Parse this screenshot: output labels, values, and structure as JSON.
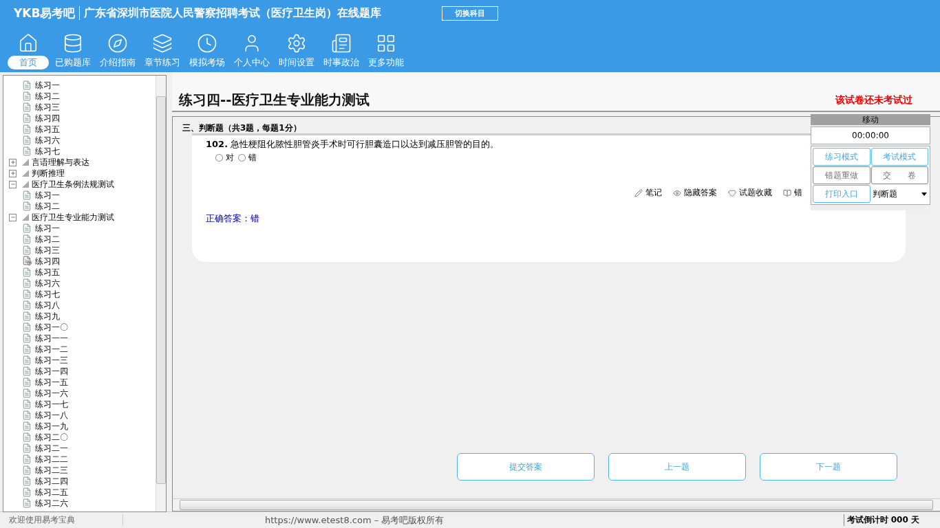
{
  "header": {
    "logo": "YKB易考吧",
    "title": "广东省深圳市医院人民警察招聘考试（医疗卫生岗）在线题库",
    "switch_button": "切换科目"
  },
  "nav": [
    {
      "label": "首页",
      "selected": true
    },
    {
      "label": "已购题库",
      "selected": false
    },
    {
      "label": "介绍指南",
      "selected": false
    },
    {
      "label": "章节练习",
      "selected": false
    },
    {
      "label": "模拟考场",
      "selected": false
    },
    {
      "label": "个人中心",
      "selected": false
    },
    {
      "label": "时间设置",
      "selected": false
    },
    {
      "label": "时事政治",
      "selected": false
    },
    {
      "label": "更多功能",
      "selected": false
    }
  ],
  "tree": [
    {
      "children": [
        {
          "children": [
            {
              "label": "练习一",
              "selected": false
            },
            {
              "label": "练习二",
              "selected": false
            },
            {
              "label": "练习三",
              "selected": false
            },
            {
              "label": "练习四",
              "selected": false
            },
            {
              "label": "练习五",
              "selected": false
            },
            {
              "label": "练习六",
              "selected": false
            },
            {
              "label": "练习七",
              "selected": false
            }
          ]
        },
        {
          "label": "言语理解与表达",
          "expanded": false
        },
        {
          "label": "判断推理",
          "expanded": false
        }
      ]
    },
    {
      "label": "医疗卫生条例法规测试",
      "expanded": true,
      "children": [
        {
          "label": "练习一",
          "selected": false
        },
        {
          "label": "练习二",
          "selected": false
        }
      ]
    },
    {
      "label": "医疗卫生专业能力测试",
      "expanded": true,
      "children": [
        {
          "label": "练习一",
          "selected": false
        },
        {
          "label": "练习二",
          "selected": false
        },
        {
          "label": "练习三",
          "selected": false
        },
        {
          "label": "练习四",
          "selected": true
        },
        {
          "label": "练习五",
          "selected": false
        },
        {
          "label": "练习六",
          "selected": false
        },
        {
          "label": "练习七",
          "selected": false
        },
        {
          "label": "练习八",
          "selected": false
        },
        {
          "label": "练习九",
          "selected": false
        },
        {
          "label": "练习一〇",
          "selected": false
        },
        {
          "label": "练习一一",
          "selected": false
        },
        {
          "label": "练习一二",
          "selected": false
        },
        {
          "label": "练习一三",
          "selected": false
        },
        {
          "label": "练习一四",
          "selected": false
        },
        {
          "label": "练习一五",
          "selected": false
        },
        {
          "label": "练习一六",
          "selected": false
        },
        {
          "label": "练习一七",
          "selected": false
        },
        {
          "label": "练习一八",
          "selected": false
        },
        {
          "label": "练习一九",
          "selected": false
        },
        {
          "label": "练习二〇",
          "selected": false
        },
        {
          "label": "练习二一",
          "selected": false
        },
        {
          "label": "练习二二",
          "selected": false
        },
        {
          "label": "练习二三",
          "selected": false
        },
        {
          "label": "练习二四",
          "selected": false
        },
        {
          "label": "练习二五",
          "selected": false
        },
        {
          "label": "练习二六",
          "selected": false
        }
      ]
    }
  ],
  "paper": {
    "title": "练习四--医疗卫生专业能力测试",
    "status": "该试卷还未考试过",
    "section": "三、判断题（共3题，每题1分）",
    "question": {
      "number": "102.",
      "text": "急性梗阻化脓性胆管炎手术时可行胆囊造口以达到减压胆管的目的。",
      "options": [
        {
          "label": "对",
          "selected": false
        },
        {
          "label": "错",
          "selected": false
        }
      ],
      "tools": [
        "笔记",
        "隐藏答案",
        "试题收藏",
        "错"
      ],
      "answer": "正确答案：错"
    },
    "buttons": [
      "提交答案",
      "上一题",
      "下一题"
    ]
  },
  "panel": {
    "header": "移动",
    "timer": "00:00:00",
    "buttons": [
      {
        "label": "练习模式",
        "disabled": false
      },
      {
        "label": "考试模式",
        "disabled": false
      },
      {
        "label": "错题重做",
        "disabled": true
      },
      {
        "label": "交　　卷",
        "disabled": true
      },
      {
        "label": "打印入口",
        "disabled": false
      }
    ],
    "select": "判断题"
  },
  "status_bar": {
    "welcome": "欢迎使用易考宝典",
    "copyright": "https://www.etest8.com – 易考吧版权所有",
    "countdown": "考试倒计时 000 天"
  }
}
